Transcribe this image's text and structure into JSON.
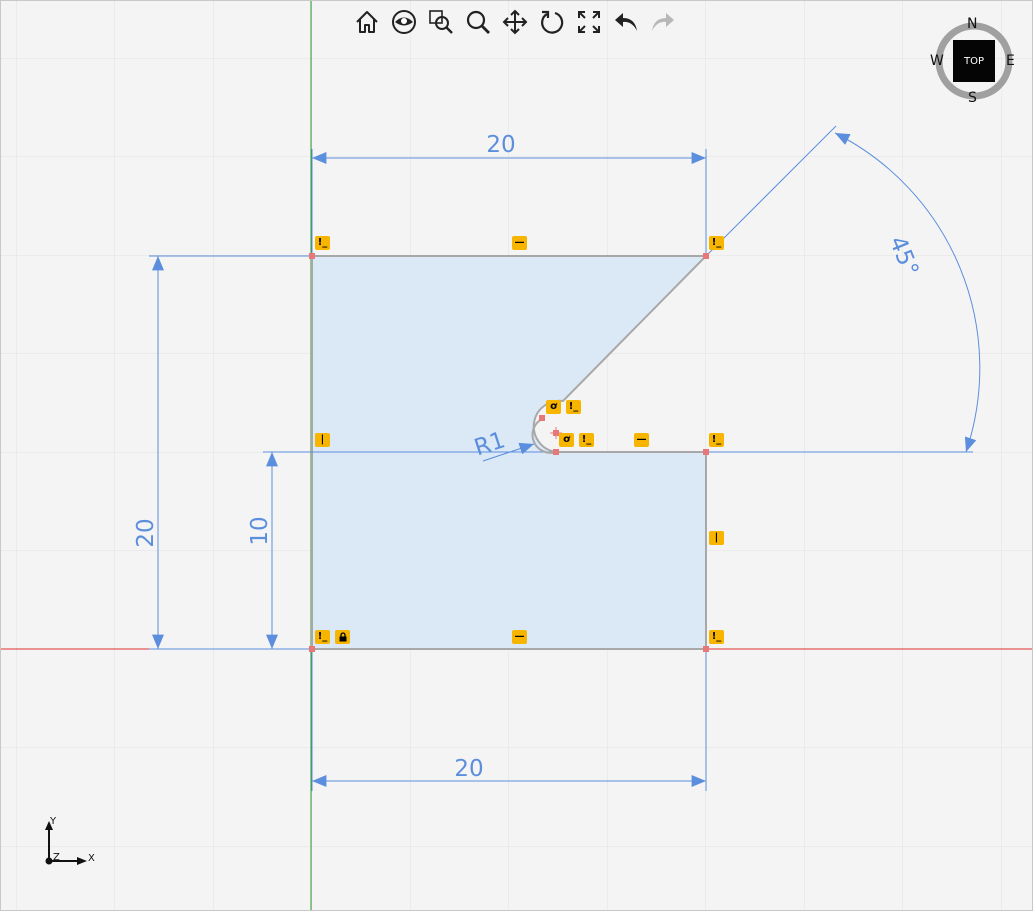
{
  "toolbar": {
    "items": [
      {
        "name": "home",
        "icon": "home-icon"
      },
      {
        "name": "view",
        "icon": "eye-icon"
      },
      {
        "name": "zoom-window",
        "icon": "zoom-window-icon"
      },
      {
        "name": "zoom",
        "icon": "magnifier-icon"
      },
      {
        "name": "pan",
        "icon": "move-arrows-icon"
      },
      {
        "name": "rotate",
        "icon": "rotate-icon"
      },
      {
        "name": "fit",
        "icon": "fit-to-screen-icon"
      },
      {
        "name": "undo",
        "icon": "undo-icon"
      },
      {
        "name": "redo",
        "icon": "redo-icon",
        "disabled": true
      }
    ]
  },
  "view_cube": {
    "face": "TOP",
    "north": "N",
    "south": "S",
    "east": "E",
    "west": "W"
  },
  "sketch": {
    "dimensions": {
      "top_width": "20",
      "bottom_width": "20",
      "left_height": "20",
      "inner_height": "10",
      "angle": "45°",
      "radius": "R1"
    },
    "colors": {
      "fill": "#dbe8f5",
      "outline": "#a8a8a8",
      "dimension": "#5c8ede",
      "x_axis": "#e03030",
      "y_axis": "#2a9a2a",
      "vertex": "#e87878",
      "badge": "#f7b500"
    }
  },
  "axis_triad": {
    "x_label": "X",
    "y_label": "Y",
    "z_label": "Z"
  }
}
